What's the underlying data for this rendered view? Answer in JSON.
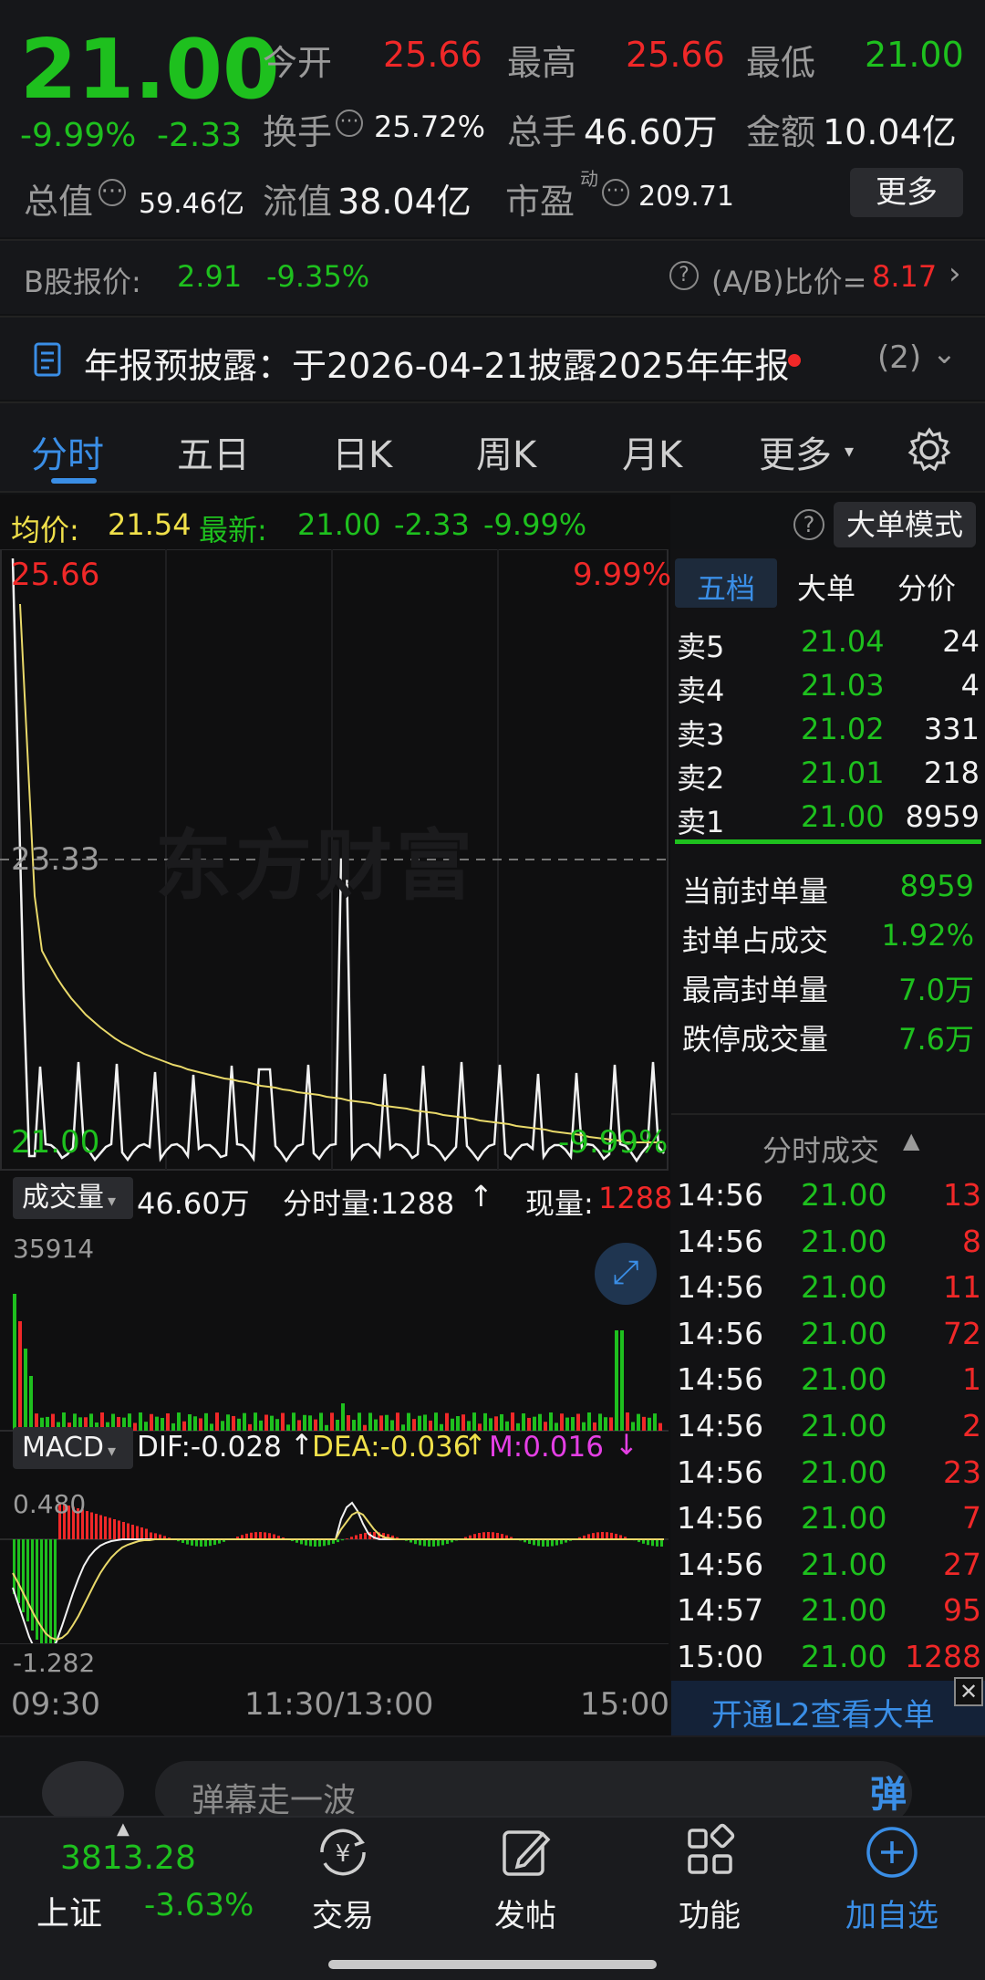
{
  "quote": {
    "price": "21.00",
    "pct": "-9.99%",
    "chg": "-2.33",
    "open_label": "今开",
    "open": "25.66",
    "high_label": "最高",
    "high": "25.66",
    "low_label": "最低",
    "low": "21.00",
    "turnover_label": "换手",
    "turnover": "25.72%",
    "volume_label": "总手",
    "volume": "46.60万",
    "amount_label": "金额",
    "amount": "10.04亿",
    "mktcap_label": "总值",
    "mktcap": "59.46亿",
    "float_label": "流值",
    "float": "38.04亿",
    "pe_label": "市盈",
    "pe_sup": "动",
    "pe": "209.71",
    "more_button": "更多"
  },
  "bshare": {
    "label": "B股报价:",
    "price": "2.91",
    "pct": "-9.35%",
    "ratio_label": "(A/B)比价=",
    "ratio": "8.17"
  },
  "notice": {
    "text": "年报预披露：于2026-04-21披露2025年年报",
    "count": "(2)"
  },
  "tabs": [
    {
      "label": "分时",
      "active": true
    },
    {
      "label": "五日"
    },
    {
      "label": "日K"
    },
    {
      "label": "周K"
    },
    {
      "label": "月K"
    },
    {
      "label": "更多"
    }
  ],
  "chart_header": {
    "avg_label": "均价:",
    "avg": "21.54",
    "latest_label": "最新:",
    "latest": "21.00",
    "chg": "-2.33",
    "pct": "-9.99%",
    "bigorder_button": "大单模式"
  },
  "price_axis": {
    "top": "25.66",
    "top_pct": "9.99%",
    "mid": "23.33",
    "bottom": "21.00",
    "bottom_pct": "-9.99%",
    "watermark": "东方财富"
  },
  "volume_header": {
    "label": "成交量",
    "total": "46.60万",
    "tick_label": "分时量:1288",
    "now_label": "现量:",
    "now": "1288",
    "max": "35914"
  },
  "macd_header": {
    "label": "MACD",
    "dif": "DIF:-0.028",
    "dea": "DEA:-0.036",
    "m": "M:0.016",
    "top": "0.480",
    "bottom": "-1.282"
  },
  "time_axis": [
    "09:30",
    "11:30/13:00",
    "15:00"
  ],
  "orderbook": {
    "tabs": [
      "五档",
      "大单",
      "分价"
    ],
    "asks": [
      {
        "label": "卖5",
        "price": "21.04",
        "vol": "24"
      },
      {
        "label": "卖4",
        "price": "21.03",
        "vol": "4"
      },
      {
        "label": "卖3",
        "price": "21.02",
        "vol": "331"
      },
      {
        "label": "卖2",
        "price": "21.01",
        "vol": "218"
      },
      {
        "label": "卖1",
        "price": "21.00",
        "vol": "8959"
      }
    ],
    "stats": [
      {
        "label": "当前封单量",
        "value": "8959"
      },
      {
        "label": "封单占成交",
        "value": "1.92%"
      },
      {
        "label": "最高封单量",
        "value": "7.0万"
      },
      {
        "label": "跌停成交量",
        "value": "7.6万"
      }
    ]
  },
  "ticks": {
    "title": "分时成交",
    "rows": [
      {
        "time": "14:56",
        "price": "21.00",
        "vol": "13"
      },
      {
        "time": "14:56",
        "price": "21.00",
        "vol": "8"
      },
      {
        "time": "14:56",
        "price": "21.00",
        "vol": "11"
      },
      {
        "time": "14:56",
        "price": "21.00",
        "vol": "72"
      },
      {
        "time": "14:56",
        "price": "21.00",
        "vol": "1"
      },
      {
        "time": "14:56",
        "price": "21.00",
        "vol": "2"
      },
      {
        "time": "14:56",
        "price": "21.00",
        "vol": "23"
      },
      {
        "time": "14:56",
        "price": "21.00",
        "vol": "7"
      },
      {
        "time": "14:56",
        "price": "21.00",
        "vol": "27"
      },
      {
        "time": "14:57",
        "price": "21.00",
        "vol": "95"
      },
      {
        "time": "15:00",
        "price": "21.00",
        "vol": "1288"
      }
    ],
    "l2_link": "开通L2查看大单"
  },
  "danmu": {
    "placeholder": "弹幕走一波",
    "badge": "弹"
  },
  "nav": {
    "index_value": "3813.28",
    "index_name": "上证",
    "index_pct": "-3.63%",
    "items": [
      "交易",
      "发帖",
      "功能",
      "加自选"
    ]
  },
  "colors": {
    "up": "#f02828",
    "down": "#1ec01e",
    "accent": "#3a8ee6",
    "avg_line": "#e9d96a"
  }
}
